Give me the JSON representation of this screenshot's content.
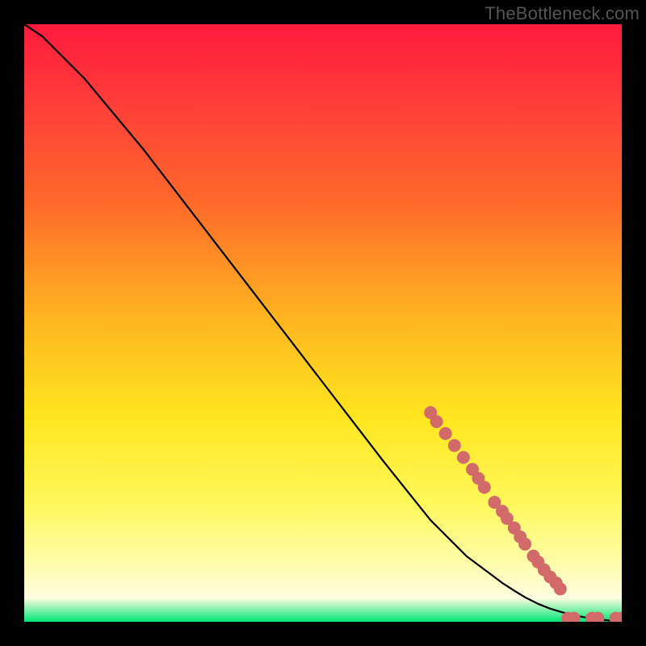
{
  "watermark": "TheBottleneck.com",
  "chart_data": {
    "type": "line",
    "title": "",
    "xlabel": "",
    "ylabel": "",
    "xlim": [
      0,
      100
    ],
    "ylim": [
      0,
      100
    ],
    "grid": false,
    "legend": false,
    "series": [
      {
        "name": "curve",
        "x": [
          0,
          3,
          6,
          10,
          15,
          20,
          30,
          40,
          50,
          60,
          68,
          70,
          72,
          74,
          76,
          78,
          80,
          82,
          84,
          86,
          88,
          90,
          92,
          94,
          96,
          98,
          100
        ],
        "y": [
          100,
          98,
          95,
          91,
          85,
          79,
          66,
          53,
          40,
          27,
          17,
          15,
          13,
          11,
          9.5,
          8,
          6.5,
          5.2,
          4,
          3,
          2.2,
          1.6,
          1.1,
          0.7,
          0.4,
          0.2,
          0.1
        ]
      }
    ],
    "markers": [
      {
        "x": 68,
        "y": 35
      },
      {
        "x": 69,
        "y": 33.5
      },
      {
        "x": 70.5,
        "y": 31.5
      },
      {
        "x": 72,
        "y": 29.5
      },
      {
        "x": 73.5,
        "y": 27.5
      },
      {
        "x": 75,
        "y": 25.5
      },
      {
        "x": 76,
        "y": 24
      },
      {
        "x": 77,
        "y": 22.5
      },
      {
        "x": 78.7,
        "y": 20
      },
      {
        "x": 80,
        "y": 18.5
      },
      {
        "x": 80.8,
        "y": 17.3
      },
      {
        "x": 82,
        "y": 15.7
      },
      {
        "x": 83,
        "y": 14.2
      },
      {
        "x": 83.8,
        "y": 13
      },
      {
        "x": 85.2,
        "y": 11
      },
      {
        "x": 86,
        "y": 10
      },
      {
        "x": 87,
        "y": 8.7
      },
      {
        "x": 88,
        "y": 7.5
      },
      {
        "x": 89,
        "y": 6.5
      },
      {
        "x": 89.7,
        "y": 5.5
      },
      {
        "x": 91,
        "y": 0.6
      },
      {
        "x": 92,
        "y": 0.6
      },
      {
        "x": 95,
        "y": 0.6
      },
      {
        "x": 96,
        "y": 0.6
      },
      {
        "x": 99,
        "y": 0.6
      },
      {
        "x": 100,
        "y": 0.6
      }
    ],
    "marker_style": {
      "color": "#d36a6a",
      "radius_px": 8
    },
    "background_gradient": [
      {
        "stop": 0.0,
        "color": "#ff1a3c"
      },
      {
        "stop": 0.12,
        "color": "#ff3a3a"
      },
      {
        "stop": 0.3,
        "color": "#ff6a2a"
      },
      {
        "stop": 0.5,
        "color": "#ffb81f"
      },
      {
        "stop": 0.66,
        "color": "#ffe61f"
      },
      {
        "stop": 0.8,
        "color": "#fff85a"
      },
      {
        "stop": 0.9,
        "color": "#fffda8"
      },
      {
        "stop": 0.96,
        "color": "#fffde0"
      },
      {
        "stop": 1.0,
        "color": "#00e676"
      }
    ]
  }
}
